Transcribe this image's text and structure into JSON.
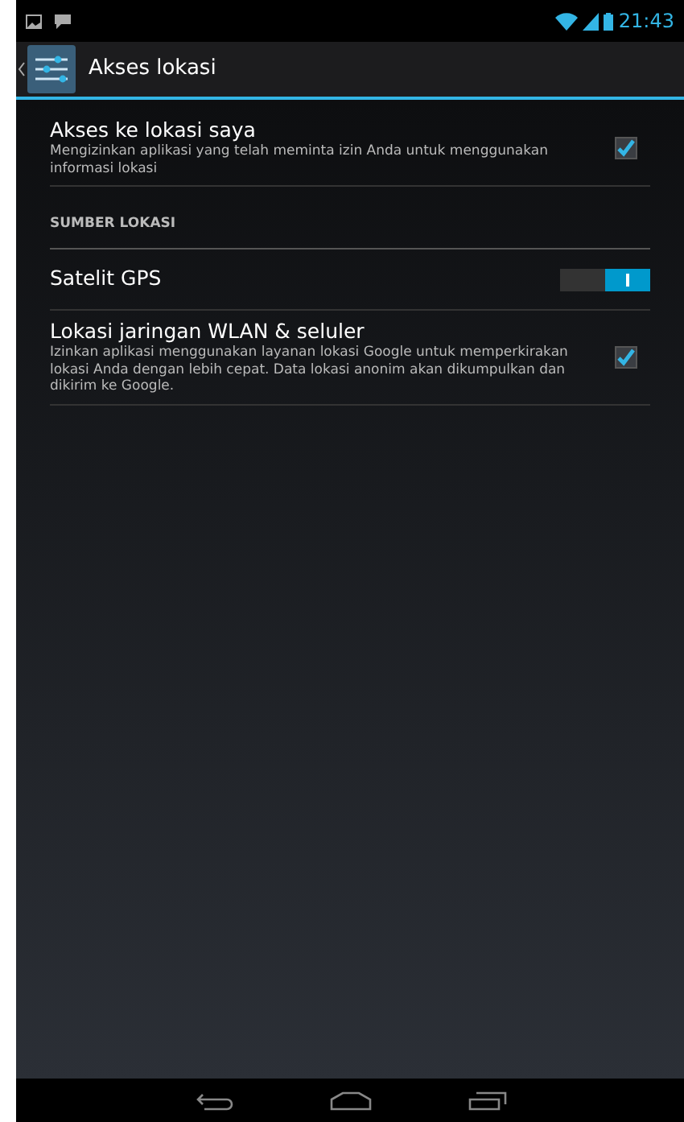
{
  "status_bar": {
    "time": "21:43"
  },
  "action_bar": {
    "title": "Akses lokasi"
  },
  "items": [
    {
      "kind": "checkbox",
      "title": "Akses ke lokasi saya",
      "summary": "Mengizinkan aplikasi yang telah meminta izin Anda untuk menggunakan informasi lokasi",
      "checked": true
    },
    {
      "kind": "header",
      "title": "SUMBER LOKASI"
    },
    {
      "kind": "switch",
      "title": "Satelit GPS",
      "on": true
    },
    {
      "kind": "checkbox",
      "title": "Lokasi jaringan WLAN & seluler",
      "summary": "Izinkan aplikasi menggunakan layanan lokasi Google untuk memperkirakan lokasi Anda dengan lebih cepat. Data lokasi anonim akan dikumpulkan dan dikirim ke Google.",
      "checked": true
    }
  ]
}
